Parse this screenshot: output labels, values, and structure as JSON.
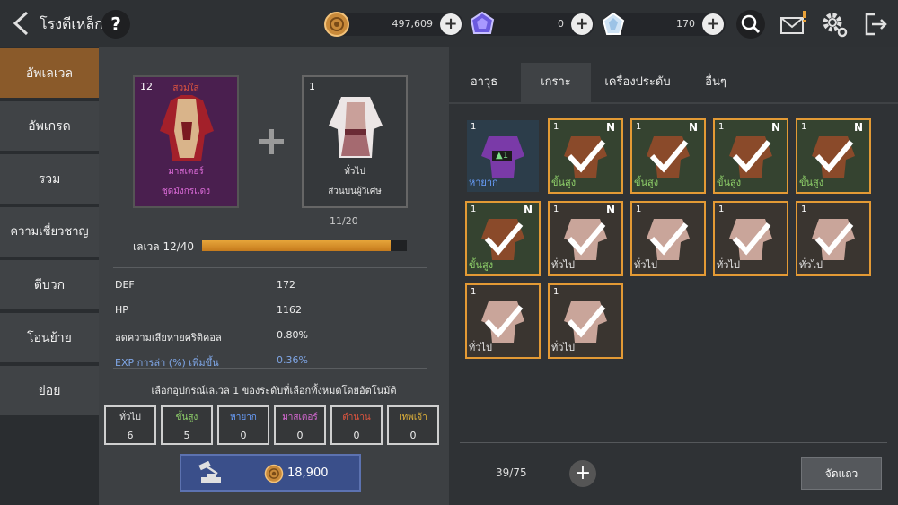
{
  "header": {
    "title": "โรงตีเหล็ก",
    "help_label": "?",
    "currencies": [
      {
        "name": "gold",
        "value": "497,609",
        "plus": "+"
      },
      {
        "name": "purple-gem",
        "value": "0",
        "plus": "+"
      },
      {
        "name": "crystal",
        "value": "170",
        "plus": "+"
      }
    ]
  },
  "menu": {
    "items": [
      {
        "label": "อัพเลเวล",
        "active": true
      },
      {
        "label": "อัพเกรด",
        "active": false
      },
      {
        "label": "รวม",
        "active": false
      },
      {
        "label": "ความเชี่ยวชาญ",
        "active": false
      },
      {
        "label": "ตีบวก",
        "active": false
      },
      {
        "label": "โอนย้าย",
        "active": false
      },
      {
        "label": "ย่อย",
        "active": false
      }
    ]
  },
  "upgrade": {
    "main_item": {
      "level": "12",
      "slot_name": "สวมใส่",
      "grade": "มาสเตอร์",
      "name": "ชุดมังกรแดง"
    },
    "material_item": {
      "level": "1",
      "grade": "ทั่วไป",
      "name": "ส่วนบนผู้วิเศษ"
    },
    "material_count": "11/20",
    "level_label": "เลเวล 12/40",
    "level_progress": 0.92,
    "stats": [
      {
        "key": "DEF",
        "value": "172",
        "color": "#eeeeee"
      },
      {
        "key": "HP",
        "value": "1162",
        "color": "#eeeeee"
      },
      {
        "key": "ลดความเสียหายคริติคอล",
        "value": "0.80%",
        "color": "#eeeeee"
      },
      {
        "key": "EXP การล่า (%) เพิ่มขึ้น",
        "value": "0.36%",
        "color": "#7fa6e6"
      }
    ],
    "auto_select_note": "เลือกอุปกรณ์เลเวล 1 ของระดับที่เลือกทั้งหมดโดยอัตโนมัติ",
    "grades": [
      {
        "label": "ทั่วไป",
        "count": "6",
        "color": "#e6e6e6"
      },
      {
        "label": "ขั้นสูง",
        "count": "5",
        "color": "#8fd16a"
      },
      {
        "label": "หายาก",
        "count": "0",
        "color": "#6aa0ff"
      },
      {
        "label": "มาสเตอร์",
        "count": "0",
        "color": "#d96ad6"
      },
      {
        "label": "ตำนาน",
        "count": "0",
        "color": "#e0553f"
      },
      {
        "label": "เทพเจ้า",
        "count": "0",
        "color": "#e0b23a"
      }
    ],
    "cost": "18,900"
  },
  "inventory": {
    "tabs": [
      {
        "label": "อาวุธ",
        "active": false
      },
      {
        "label": "เกราะ",
        "active": true
      },
      {
        "label": "เครื่องประดับ",
        "active": false
      },
      {
        "label": "อื่นๆ",
        "active": false
      }
    ],
    "slots": [
      {
        "qty": "1",
        "grade": "หายาก",
        "grade_color": "#6aa0ff",
        "new": false,
        "checked": false,
        "badge": "▲1"
      },
      {
        "qty": "1",
        "grade": "ขั้นสูง",
        "grade_color": "#8fd16a",
        "new": true,
        "checked": true
      },
      {
        "qty": "1",
        "grade": "ขั้นสูง",
        "grade_color": "#8fd16a",
        "new": true,
        "checked": true
      },
      {
        "qty": "1",
        "grade": "ขั้นสูง",
        "grade_color": "#8fd16a",
        "new": true,
        "checked": true
      },
      {
        "qty": "1",
        "grade": "ขั้นสูง",
        "grade_color": "#8fd16a",
        "new": true,
        "checked": true
      },
      {
        "qty": "1",
        "grade": "ขั้นสูง",
        "grade_color": "#8fd16a",
        "new": true,
        "checked": true
      },
      {
        "qty": "1",
        "grade": "ทั่วไป",
        "grade_color": "#e6e6e6",
        "new": true,
        "checked": true
      },
      {
        "qty": "1",
        "grade": "ทั่วไป",
        "grade_color": "#e6e6e6",
        "new": false,
        "checked": true
      },
      {
        "qty": "1",
        "grade": "ทั่วไป",
        "grade_color": "#e6e6e6",
        "new": false,
        "checked": true
      },
      {
        "qty": "1",
        "grade": "ทั่วไป",
        "grade_color": "#e6e6e6",
        "new": false,
        "checked": true
      },
      {
        "qty": "1",
        "grade": "ทั่วไป",
        "grade_color": "#e6e6e6",
        "new": false,
        "checked": true
      },
      {
        "qty": "1",
        "grade": "ทั่วไป",
        "grade_color": "#e6e6e6",
        "new": false,
        "checked": true
      }
    ],
    "new_badge": "N",
    "count": "39/75",
    "add_label": "+",
    "sort_label": "จัดแถว"
  },
  "colors": {
    "accent": "#e39a35",
    "active_menu": "#8a5a2a",
    "button_blue": "#3a4f8a"
  }
}
